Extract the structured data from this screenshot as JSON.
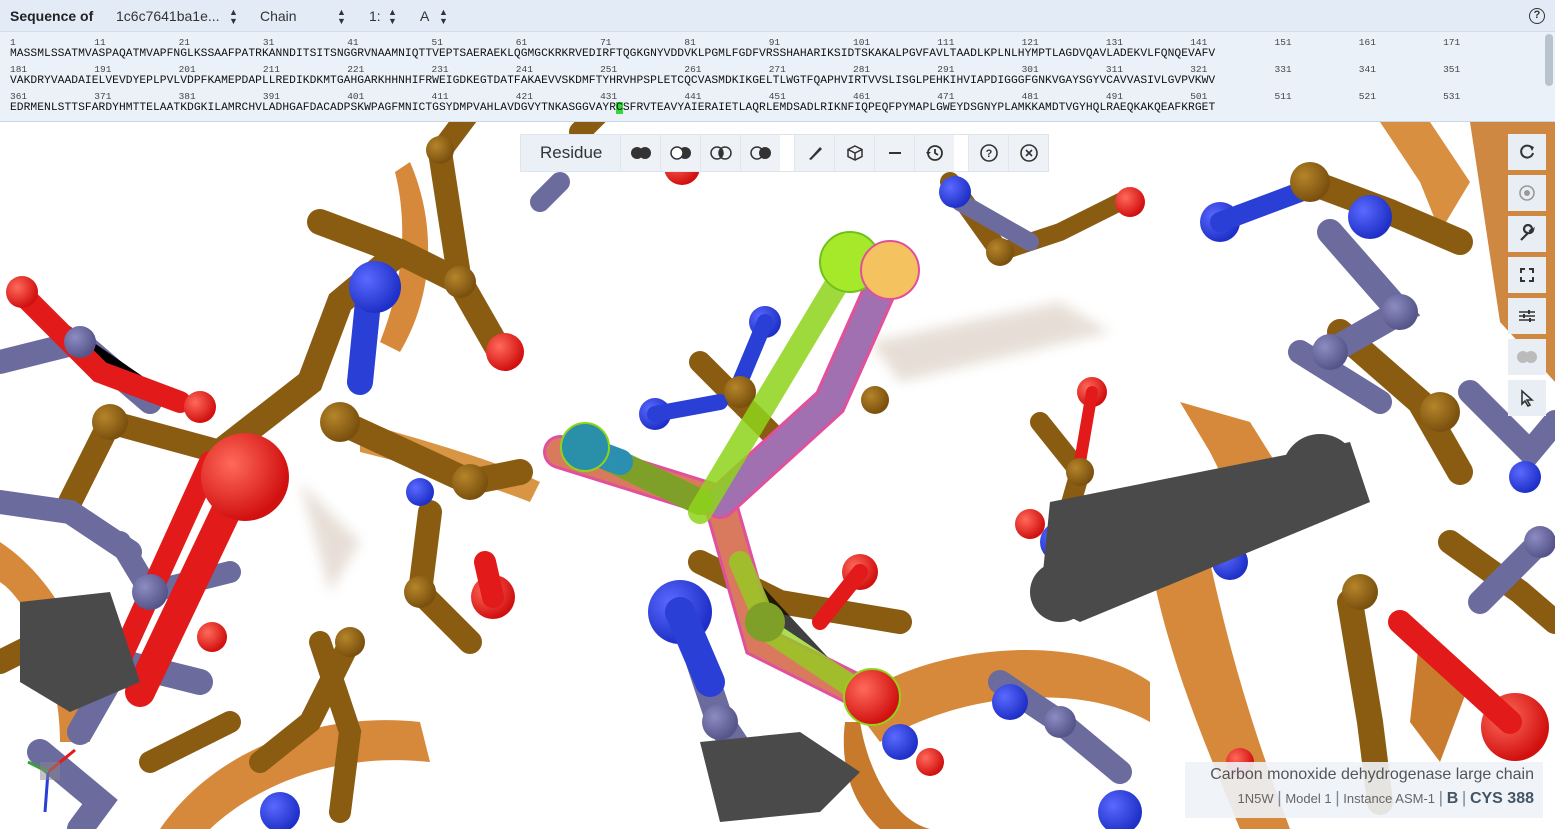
{
  "sequence_header": {
    "label": "Sequence of",
    "entity_select": "1c6c7641ba1e...",
    "kind_select": "Chain",
    "instance_select": "1:",
    "chain_select": "A"
  },
  "sequence_lines": [
    {
      "numbers": [
        "1",
        "11",
        "21",
        "31",
        "41",
        "51",
        "61",
        "71",
        "81",
        "91",
        "101",
        "111",
        "121",
        "131",
        "141",
        "151",
        "161",
        "171"
      ],
      "before": "MASSMLSSATMVASPAQATMVAPFNGLKSSAAFPATRKANNDITSITSNGGRVNAAMNIQTTVEPTSAERAEKLQGMGCKRKRVEDIRFTQGKGNYVDDVKLPGMLFGDFVRSSHAHARIKSIDTSKAKALPGVFAVLTAADLKPLNLHYMPTLAGDVQAVLADEKVLFQNQEVAFV",
      "highlight": "",
      "after": ""
    },
    {
      "numbers": [
        "181",
        "191",
        "201",
        "211",
        "221",
        "231",
        "241",
        "251",
        "261",
        "271",
        "281",
        "291",
        "301",
        "311",
        "321",
        "331",
        "341",
        "351"
      ],
      "before": "VAKDRYVAADAIELVEVDYEPLPVLVDPFKAMEPDAPLLREDIKDKMTGAHGARKHHNHIFRWEIGDKEGTDATFAKAEVVSKDMFTYHRVHPSPLETCQCVASMDKIKGELTLWGTFQAPHVIRTVVSLISGLPEHKIHVIAPDIGGGFGNKVGAYSGYVCAVVASIVLGVPVKWV",
      "highlight": "",
      "after": ""
    },
    {
      "numbers": [
        "361",
        "371",
        "381",
        "391",
        "401",
        "411",
        "421",
        "431",
        "441",
        "451",
        "461",
        "471",
        "481",
        "491",
        "501",
        "511",
        "521",
        "531"
      ],
      "before": "EDRMENLSTTSFARDYHMTTELAATKDGKILAMRCHVLADHGAFDACADPSKWPAGFMNICTGSYDMPVAHLAVDGVYTNKASGGVAYR",
      "highlight": "C",
      "after": "SFRVTEAVYAIERAIETLAQRLEMDSADLRIKNFIQPEQFPYMAPLGWEYDSGNYPLAMKKAMDTVGYHQLRAEQKAKQEAFKRGET"
    }
  ],
  "toolbar": {
    "mode_label": "Residue",
    "buttons": [
      "union-icon",
      "subtract-icon",
      "intersect-icon",
      "set-icon",
      "paint-icon",
      "cube-icon",
      "minus-icon",
      "history-icon",
      "help-icon",
      "close-icon"
    ]
  },
  "side_controls": [
    "reset-view-icon",
    "camera-icon",
    "wrench-icon",
    "fullscreen-icon",
    "sliders-icon",
    "selection-mode-icon",
    "pointer-icon"
  ],
  "highlight_info": {
    "title": "Carbon monoxide dehydrogenase large chain",
    "entry": "1N5W",
    "model": "Model 1",
    "instance": "Instance ASM-1",
    "chain": "B",
    "residue": "CYS 388"
  },
  "colors": {
    "panel_bg": "#eaf1f9",
    "highlight_residue": "#35d63a",
    "carbon_gold": "#8a5c12",
    "ribbon_orange": "#d6893a",
    "carbon_slate": "#6b6b9e",
    "nitrogen": "#2a3fd6",
    "oxygen": "#e31a1a",
    "selection_green": "#8fd41b",
    "selection_pink": "#e0509c"
  }
}
